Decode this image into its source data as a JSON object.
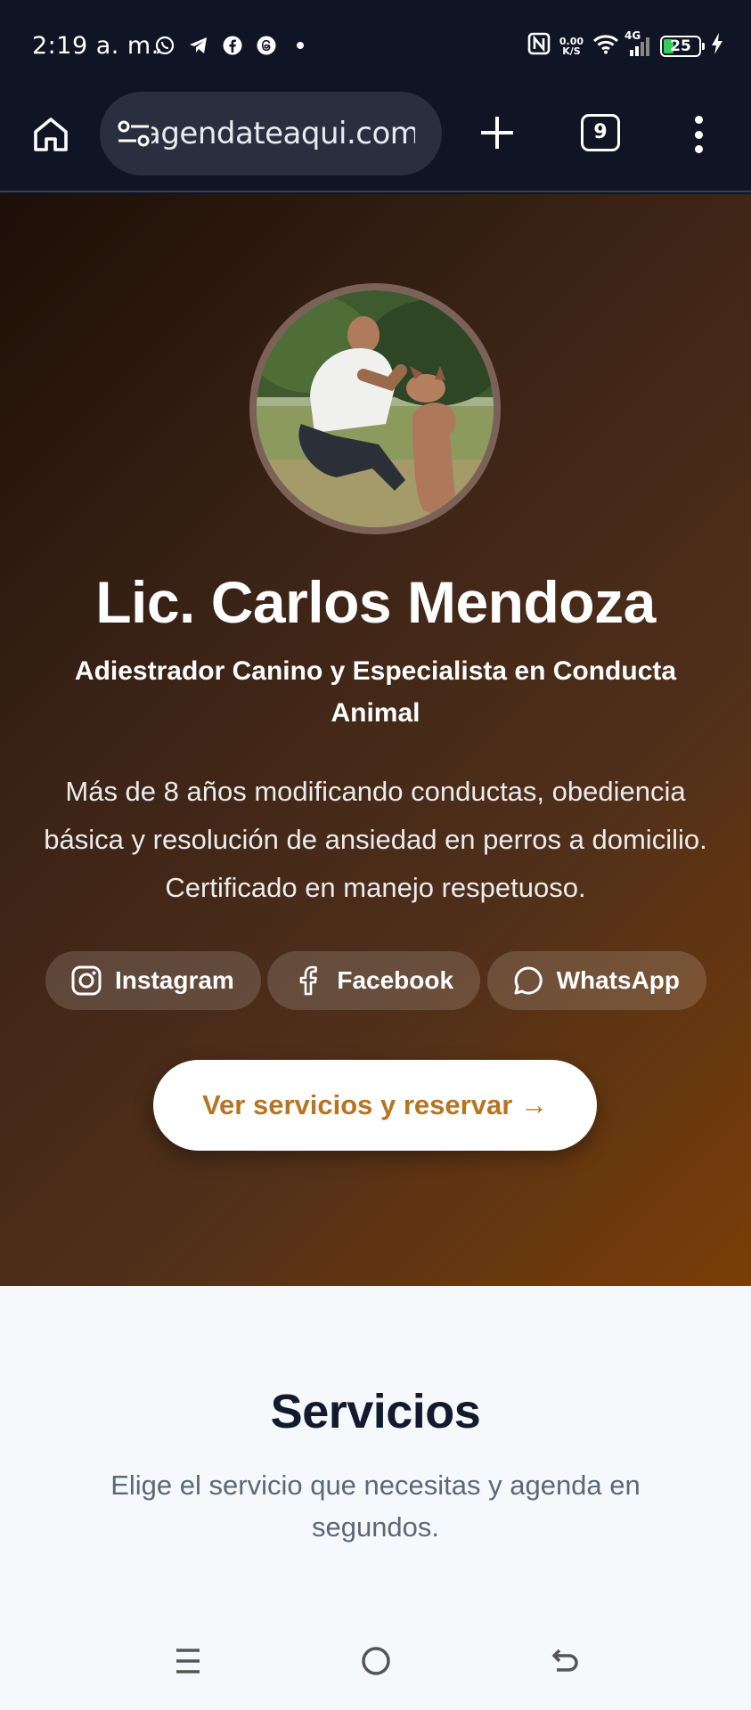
{
  "status_bar": {
    "time": "2:19 a. m.",
    "app_icons": [
      "whatsapp-icon",
      "telegram-icon",
      "facebook-icon",
      "threads-icon",
      "dot-icon"
    ],
    "net_speed_value": "0.00",
    "net_speed_unit": "K/S",
    "network": "4G",
    "battery": "25"
  },
  "browser": {
    "url": "agendateaqui.com",
    "tab_count": "9"
  },
  "hero": {
    "name": "Lic. Carlos Mendoza",
    "subtitle": "Adiestrador Canino y Especialista en Conducta Animal",
    "description": "Más de 8 años modificando conductas, obediencia básica y resolución de ansiedad en perros a domicilio. Certificado en manejo respetuoso.",
    "socials": [
      {
        "label": "Instagram",
        "icon": "instagram-icon"
      },
      {
        "label": "Facebook",
        "icon": "facebook-icon"
      },
      {
        "label": "WhatsApp",
        "icon": "whatsapp-icon"
      }
    ],
    "cta": "Ver servicios y reservar →"
  },
  "services": {
    "title": "Servicios",
    "subtitle": "Elige el servicio que necesitas y agenda en segundos."
  },
  "colors": {
    "accent": "#b8741f",
    "hero_dark": "#1c0f07",
    "hero_light": "#7a3e07",
    "page_bg": "#f6f9fc",
    "heading": "#111a2e"
  }
}
